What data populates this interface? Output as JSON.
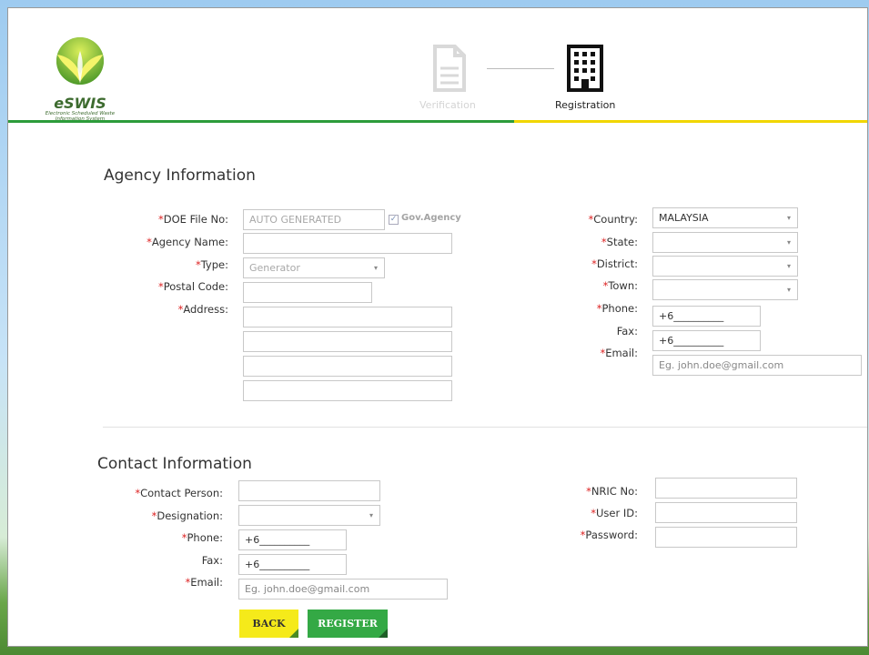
{
  "logo": {
    "name": "eSWIS",
    "subtitle_line1": "Electronic Scheduled Waste",
    "subtitle_line2": "Information System"
  },
  "steps": [
    {
      "label": "Verification",
      "icon": "document-icon",
      "state": "completed"
    },
    {
      "label": "Registration",
      "icon": "building-icon",
      "state": "active"
    }
  ],
  "colors": {
    "progress_done": "#2c9c3a",
    "progress_active": "#f1d600",
    "required": "#d22",
    "back_button": "#f5ea1a",
    "register_button": "#34a945"
  },
  "agency": {
    "title": "Agency Information",
    "doe_file_no": {
      "label": "DOE File No:",
      "value": "AUTO GENERATED"
    },
    "gov_agency": {
      "label": "Gov.Agency",
      "checked": true
    },
    "agency_name": {
      "label": "Agency Name:",
      "value": ""
    },
    "type": {
      "label": "Type:",
      "value": "Generator"
    },
    "postal_code": {
      "label": "Postal Code:",
      "value": ""
    },
    "address": {
      "label": "Address:",
      "lines": [
        "",
        "",
        "",
        ""
      ]
    },
    "country": {
      "label": "Country:",
      "value": "MALAYSIA"
    },
    "state": {
      "label": "State:",
      "value": ""
    },
    "district": {
      "label": "District:",
      "value": ""
    },
    "town": {
      "label": "Town:",
      "value": ""
    },
    "phone": {
      "label": "Phone:",
      "value": "+6__________"
    },
    "fax": {
      "label": "Fax:",
      "value": "+6__________"
    },
    "email": {
      "label": "Email:",
      "placeholder": "Eg. john.doe@gmail.com"
    }
  },
  "contact": {
    "title": "Contact Information",
    "contact_person": {
      "label": "Contact Person:",
      "value": ""
    },
    "designation": {
      "label": "Designation:",
      "value": ""
    },
    "phone": {
      "label": "Phone:",
      "value": "+6__________"
    },
    "fax": {
      "label": "Fax:",
      "value": "+6__________"
    },
    "email": {
      "label": "Email:",
      "placeholder": "Eg. john.doe@gmail.com"
    },
    "nric_no": {
      "label": "NRIC No:",
      "value": ""
    },
    "user_id": {
      "label": "User ID:",
      "value": ""
    },
    "password": {
      "label": "Password:",
      "value": ""
    }
  },
  "buttons": {
    "back": "BACK",
    "register": "REGISTER"
  }
}
